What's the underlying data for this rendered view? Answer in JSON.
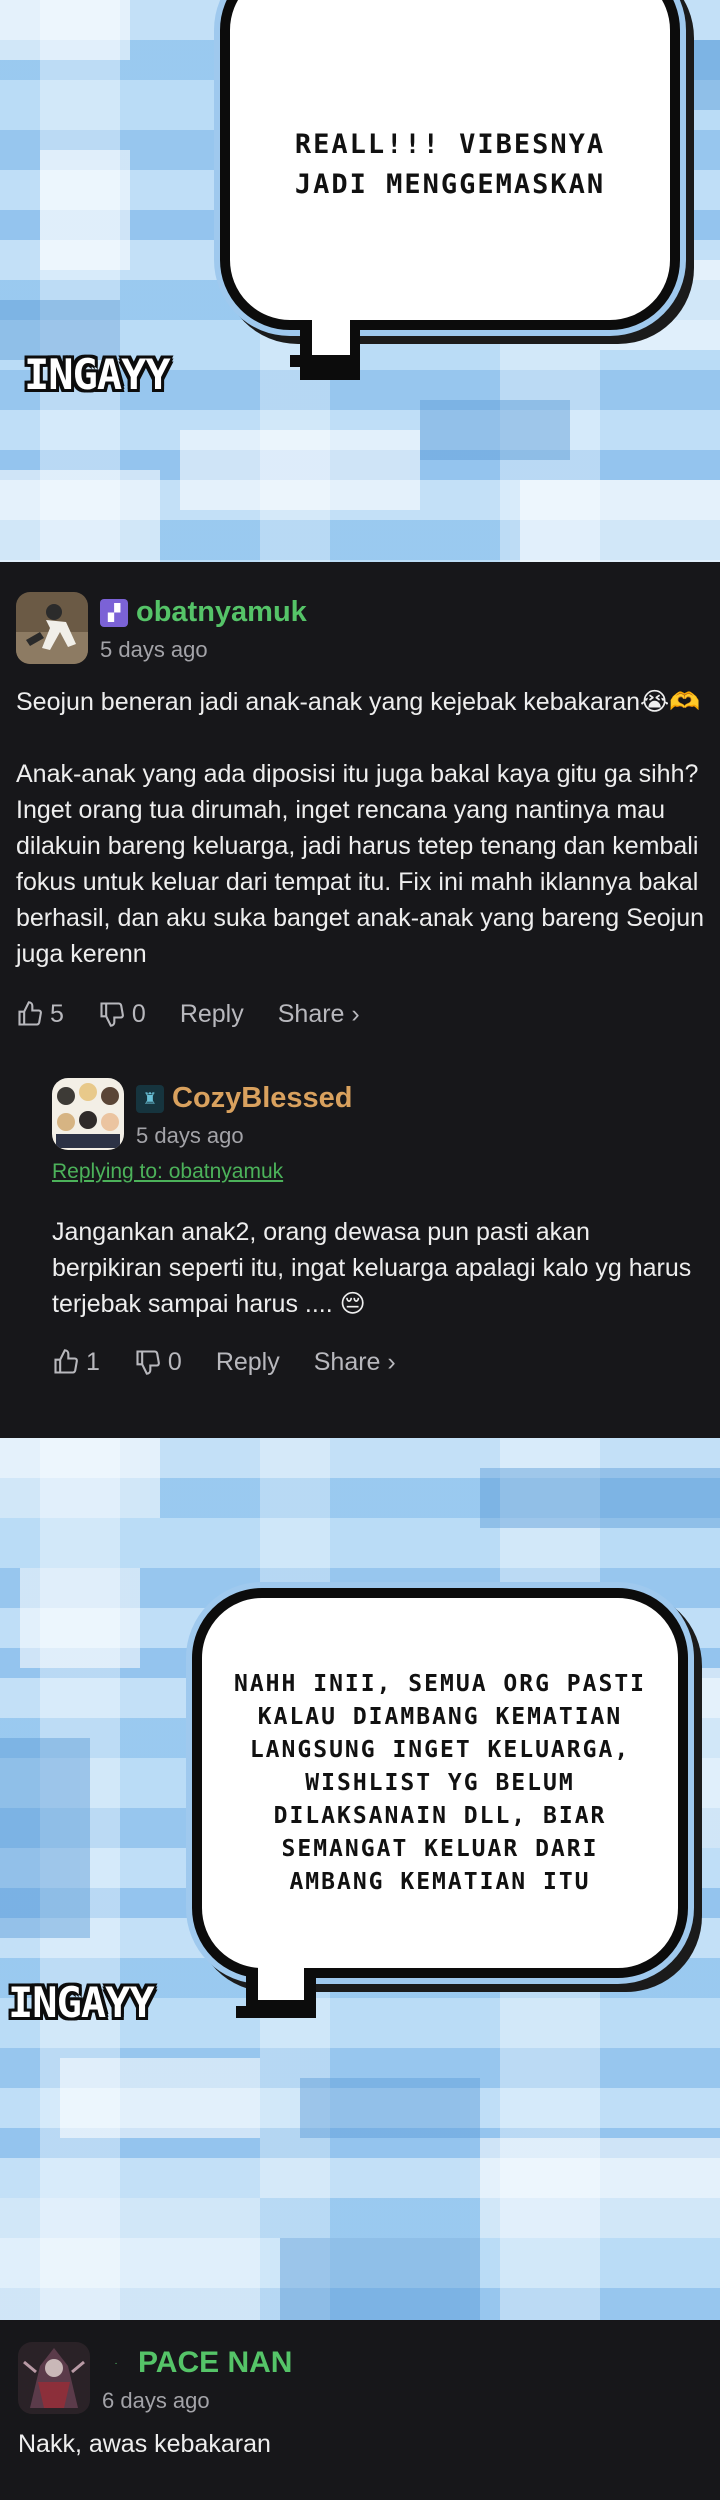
{
  "panel_top": {
    "speech_text": "REALL!!! VIBESNYA JADI MENGGEMASKAN",
    "speaker_label": "INGAYY"
  },
  "comment1": {
    "username": "obatnyamuk",
    "time": "5 days ago",
    "text": "Seojun beneran jadi anak-anak yang kejebak kebakaran😭🫶\n\nAnak-anak yang ada diposisi itu juga bakal kaya gitu ga sihh? Inget orang tua dirumah, inget rencana yang nantinya mau dilakuin bareng keluarga, jadi harus tetep tenang dan kembali fokus untuk keluar dari tempat itu. Fix ini mahh iklannya bakal berhasil, dan aku suka banget anak-anak yang bareng Seojun juga kerenn",
    "likes": "5",
    "dislikes": "0",
    "reply_label": "Reply",
    "share_label": "Share ›",
    "name_color": "#55c468"
  },
  "reply1": {
    "username": "CozyBlessed",
    "time": "5 days ago",
    "replying_to": "Replying to: obatnyamuk",
    "text": "Jangankan anak2, orang dewasa pun pasti akan berpikiran seperti itu, ingat keluarga apalagi kalo yg harus terjebak sampai harus .... 😔",
    "likes": "1",
    "dislikes": "0",
    "reply_label": "Reply",
    "share_label": "Share ›",
    "name_color": "#d9a15e"
  },
  "panel_mid": {
    "speech_text": "NAHH INII, SEMUA ORG PASTI KALAU DIAMBANG KEMATIAN LANGSUNG INGET KELUARGA, WISHLIST YG BELUM DILAKSANAIN DLL, BIAR SEMANGAT KELUAR DARI AMBANG KEMATIAN ITU",
    "speaker_label": "INGAYY"
  },
  "comment2": {
    "username": "PACE NAN",
    "time": "6 days ago",
    "text": "Nakk, awas kebakaran",
    "name_color": "#55c468"
  }
}
